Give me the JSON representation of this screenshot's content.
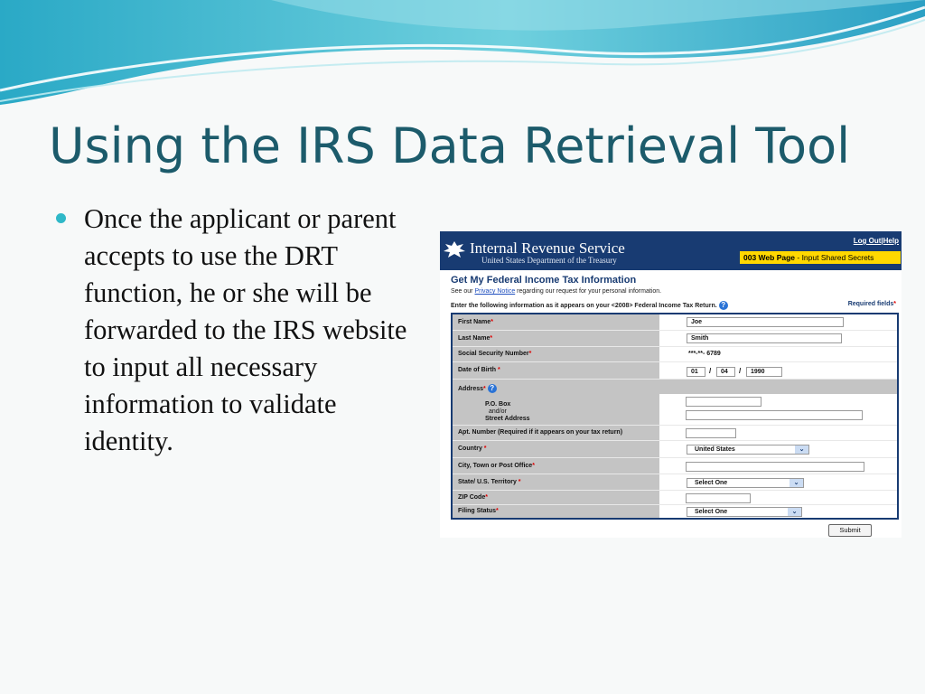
{
  "slide": {
    "title": "Using the IRS Data Retrieval Tool",
    "bullet": "Once the applicant or parent accepts to use the DRT function, he or she will be forwarded to the IRS website to input all necessary information to validate identity."
  },
  "irs": {
    "header": {
      "name": "Internal Revenue Service",
      "subtitle": "United States Department of the Treasury",
      "logout": "Log Out",
      "separator": "|",
      "help": "Help",
      "page_id": "003 Web Page",
      "page_desc": " - Input Shared Secrets"
    },
    "form_title": "Get My Federal Income Tax Information",
    "privacy_prefix": "See our",
    "privacy_link": "Privacy Notice",
    "privacy_suffix": "regarding our request for your personal information.",
    "instruction": "Enter the following information as it appears on your <2008> Federal Income Tax Return.",
    "required_label": "Required fields",
    "required_star": "*",
    "labels": {
      "first_name": "First Name",
      "last_name": "Last Name",
      "ssn": "Social Security Number",
      "dob": "Date of Birth",
      "address": "Address",
      "po_box": "P.O. Box",
      "and_or": "and/or",
      "street": "Street Address",
      "apt": "Apt. Number (Required if it appears on your tax return)",
      "country": "Country",
      "city": "City, Town or Post Office",
      "state": "State/ U.S. Territory",
      "zip": "ZIP Code",
      "filing": "Filing Status"
    },
    "values": {
      "first_name": "Joe",
      "last_name": "Smith",
      "ssn": "***-**- 6789",
      "dob_month": "01",
      "dob_day": "04",
      "dob_year": "1990",
      "dob_sep": "/",
      "country": "United States",
      "state": "Select One",
      "filing": "Select One"
    },
    "help_icon_glyph": "?",
    "dropdown_glyph": "⌄",
    "submit": "Submit",
    "colors": {
      "header": "#183b72",
      "badge": "#ffd800",
      "table": "#c4c4c4"
    }
  }
}
